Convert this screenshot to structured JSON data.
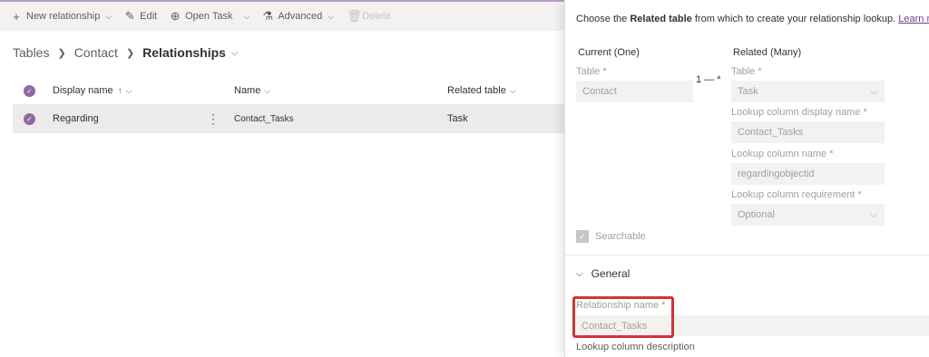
{
  "toolbar": {
    "new_relationship": "New relationship",
    "edit": "Edit",
    "open_task": "Open Task",
    "advanced": "Advanced",
    "delete": "Delete"
  },
  "breadcrumb": {
    "tables": "Tables",
    "contact": "Contact",
    "relationships": "Relationships"
  },
  "grid": {
    "columns": {
      "display_name": "Display name",
      "name": "Name",
      "related_table": "Related table"
    },
    "rows": [
      {
        "display_name": "Regarding",
        "name": "Contact_Tasks",
        "related_table": "Task"
      }
    ]
  },
  "panel": {
    "intro_prefix": "Choose the ",
    "intro_bold": "Related table",
    "intro_suffix": " from which to create your relationship lookup. ",
    "learn_more": "Learn more",
    "current_heading": "Current (One)",
    "related_heading": "Related (Many)",
    "table_label": "Table",
    "required_mark": "*",
    "current_table_value": "Contact",
    "related_table_value": "Task",
    "cardinality": "1 — *",
    "lookup_display_label": "Lookup column display name",
    "lookup_display_value": "Contact_Tasks",
    "lookup_name_label": "Lookup column name",
    "lookup_name_value": "regardingobjectid",
    "lookup_req_label": "Lookup column requirement",
    "lookup_req_value": "Optional",
    "searchable_label": "Searchable",
    "general_section": "General",
    "relationship_name_label": "Relationship name",
    "relationship_name_value": "Contact_Tasks",
    "lookup_description_label": "Lookup column description"
  },
  "colors": {
    "accent": "#8e69a4",
    "highlight": "#d13438",
    "link": "#6b3f8f"
  }
}
